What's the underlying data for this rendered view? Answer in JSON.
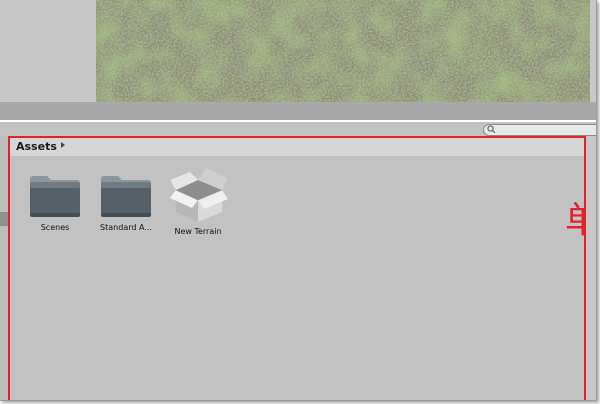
{
  "project_panel": {
    "breadcrumb": "Assets",
    "items": [
      {
        "label": "Scenes",
        "icon": "folder-icon"
      },
      {
        "label": "Standard A...",
        "icon": "folder-icon"
      },
      {
        "label": "New Terrain",
        "icon": "terrain-asset-icon"
      }
    ]
  },
  "annotation": {
    "glyph": "单"
  },
  "colors": {
    "highlight": "#e2212a",
    "panel_bg": "#c2c2c2",
    "folder": "#5b646c"
  }
}
